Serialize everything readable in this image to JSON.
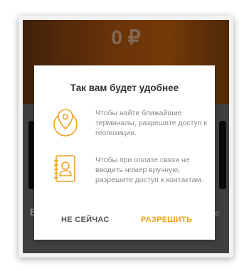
{
  "background": {
    "balance": "0 ₽",
    "left_text": "Б",
    "right_text": "е"
  },
  "dialog": {
    "title": "Так вам будет удобнее",
    "permissions": [
      {
        "icon": "location-pin-icon",
        "text": "Чтобы найти ближайшие терминалы, разрешите доступ к геопозиции."
      },
      {
        "icon": "contacts-book-icon",
        "text": "Чтобы при оплате связи не вводить номер вручную, разрешите доступ к контактам."
      }
    ],
    "buttons": {
      "later": "НЕ СЕЙЧАС",
      "allow": "РАЗРЕШИТЬ"
    }
  },
  "colors": {
    "accent": "#f0a020",
    "header_orange": "#c9640c"
  }
}
